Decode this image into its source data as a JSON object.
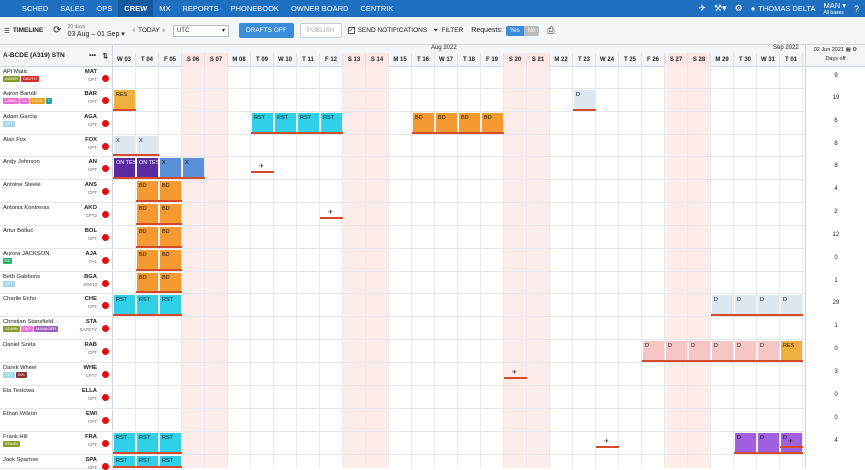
{
  "nav": {
    "items": [
      "SCHED",
      "SALES",
      "OPS",
      "CREW",
      "MX",
      "REPORTS",
      "PHONEBOOK",
      "OWNER BOARD",
      "CENTRIK"
    ],
    "active": "CREW",
    "user": "THOMAS DELTA",
    "base": "MAN",
    "base_sub": "All bases"
  },
  "toolbar": {
    "timeline": "TIMELINE",
    "range_days": "30 days",
    "range": "03 Aug – 01 Sep",
    "today": "TODAY",
    "timezone": "UTC",
    "drafts": "DRAFTS OFF",
    "publish": "PUBLISH",
    "send_notifications": "SEND NOTIFICATIONS",
    "filter": "FILTER",
    "requests": "Requests:",
    "yes": "Yes",
    "no": "No"
  },
  "grid": {
    "group_label": "A-BCDE (A319) STN",
    "month_aug": "Aug 2022",
    "month_sep": "Sep 2022",
    "right_date": "02 Jun 2021",
    "right_label": "Days off",
    "days": [
      "W 03",
      "T 04",
      "F 05",
      "S 06",
      "S 07",
      "M 08",
      "T 09",
      "W 10",
      "T 11",
      "F 12",
      "S 13",
      "S 14",
      "M 15",
      "T 16",
      "W 17",
      "T 18",
      "F 19",
      "S 20",
      "S 21",
      "M 22",
      "T 23",
      "W 24",
      "T 25",
      "F 26",
      "S 27",
      "S 28",
      "M 29",
      "T 30",
      "W 31",
      "T 01"
    ],
    "weekend_idx": [
      3,
      4,
      10,
      11,
      17,
      18,
      24,
      25
    ]
  },
  "crew": [
    {
      "name": "API Matic",
      "code": "MAT",
      "rank": "CPT",
      "tags": [
        {
          "t": "ADMIN",
          "c": "#8a9a2a"
        },
        {
          "t": "DAUTH",
          "c": "#d03030"
        }
      ],
      "days_off": "9"
    },
    {
      "name": "Aaron Bartoli",
      "code": "BAR",
      "rank": "CPT",
      "tags": [
        {
          "t": "LABEL",
          "c": "#e870d0"
        },
        {
          "t": "LL",
          "c": "#e870d0"
        },
        {
          "t": "XXXX",
          "c": "#f0a020"
        },
        {
          "t": "T",
          "c": "#20a0a0"
        }
      ],
      "days_off": "19"
    },
    {
      "name": "Adam Garcia",
      "code": "AGA",
      "rank": "CPT",
      "tags": [
        {
          "t": "CPT",
          "c": "#a0d8e8"
        }
      ],
      "days_off": "6"
    },
    {
      "name": "Alan Fox",
      "code": "FOX",
      "rank": "CPT",
      "tags": [],
      "days_off": "8"
    },
    {
      "name": "Andy Johnson",
      "code": "AN",
      "rank": "CPT",
      "tags": [],
      "days_off": "8"
    },
    {
      "name": "Antoine Steele",
      "code": "ANS",
      "rank": "CPT",
      "tags": [],
      "days_off": "4"
    },
    {
      "name": "Antonia Kontreras",
      "code": "AKO",
      "rank": "CPT2",
      "tags": [],
      "days_off": "2"
    },
    {
      "name": "Artur Boltuć",
      "code": "BOL",
      "rank": "CPT",
      "tags": [],
      "days_off": "12"
    },
    {
      "name": "Aurora JACKSON",
      "code": "AJA",
      "rank": "FA1",
      "tags": [
        {
          "t": "FA",
          "c": "#30b070"
        }
      ],
      "days_off": "0"
    },
    {
      "name": "Beth Gabbons",
      "code": "BGA",
      "rank": "SPA10",
      "tags": [
        {
          "t": "CPT",
          "c": "#a0d8e8"
        }
      ],
      "days_off": "1"
    },
    {
      "name": "Charlie Echo",
      "code": "CHE",
      "rank": "CPT",
      "tags": [],
      "days_off": "29"
    },
    {
      "name": "Christian Stansfield",
      "code": "STA",
      "rank": "SAFETY",
      "tags": [
        {
          "t": "ADMIN",
          "c": "#8a9a2a"
        },
        {
          "t": "DEF",
          "c": "#e870d0"
        },
        {
          "t": "MANAGER",
          "c": "#a060c0"
        }
      ],
      "days_off": "1"
    },
    {
      "name": "Daniel Szela",
      "code": "RAB",
      "rank": "CPT",
      "tags": [],
      "days_off": "0"
    },
    {
      "name": "Darek Wheel",
      "code": "WHE",
      "rank": "CPT7",
      "tags": [
        {
          "t": "CPT",
          "c": "#a0d8e8"
        },
        {
          "t": "INS",
          "c": "#8a3030"
        }
      ],
      "days_off": "3"
    },
    {
      "name": "Ela Testowa",
      "code": "ELLA",
      "rank": "CPT",
      "tags": [],
      "days_off": "0"
    },
    {
      "name": "Ethan Wilson",
      "code": "EWI",
      "rank": "CPT",
      "tags": [],
      "days_off": "0"
    },
    {
      "name": "Frank Hill",
      "code": "FRA",
      "rank": "CPT",
      "tags": [
        {
          "t": "ADMIN",
          "c": "#8a9a2a"
        }
      ],
      "days_off": "4"
    },
    {
      "name": "Jack Sparrow",
      "code": "SPA",
      "rank": "CPT",
      "tags": [],
      "days_off": ""
    }
  ],
  "duties": [
    {
      "row": 1,
      "start": 0,
      "len": 1,
      "label": "RES",
      "color": "#f0b040"
    },
    {
      "row": 1,
      "start": 20,
      "len": 1,
      "label": "D",
      "color": "#dde7f0"
    },
    {
      "row": 2,
      "start": 6,
      "len": 4,
      "label": "RST",
      "color": "#30d0e8",
      "split": true
    },
    {
      "row": 2,
      "start": 13,
      "len": 4,
      "label": "BD",
      "color": "#f59a30",
      "split": true
    },
    {
      "row": 3,
      "start": 0,
      "len": 2,
      "label": "X",
      "color": "#dde7f0",
      "split": true
    },
    {
      "row": 4,
      "start": 0,
      "len": 2,
      "label": "ON TES",
      "color": "#5a2aa0",
      "split": true,
      "light": true
    },
    {
      "row": 4,
      "start": 2,
      "len": 1,
      "label": "X",
      "color": "#5b8fd8"
    },
    {
      "row": 4,
      "start": 3,
      "len": 1,
      "label": "X",
      "color": "#5b8fd8"
    },
    {
      "row": 5,
      "start": 1,
      "len": 2,
      "label": "BD",
      "color": "#f59a30",
      "split": true
    },
    {
      "row": 6,
      "start": 1,
      "len": 2,
      "label": "BD",
      "color": "#f59a30",
      "split": true
    },
    {
      "row": 7,
      "start": 1,
      "len": 2,
      "label": "BD",
      "color": "#f59a30",
      "split": true
    },
    {
      "row": 8,
      "start": 1,
      "len": 2,
      "label": "BD",
      "color": "#f59a30",
      "split": true
    },
    {
      "row": 9,
      "start": 1,
      "len": 2,
      "label": "BD",
      "color": "#f59a30",
      "split": true
    },
    {
      "row": 10,
      "start": 0,
      "len": 3,
      "label": "RST",
      "color": "#30d0e8",
      "split": true
    },
    {
      "row": 10,
      "start": 26,
      "len": 4,
      "label": "D",
      "color": "#dde7f0",
      "split": true
    },
    {
      "row": 12,
      "start": 23,
      "len": 6,
      "label": "D",
      "color": "#f6c6c6",
      "split": true
    },
    {
      "row": 12,
      "start": 29,
      "len": 1,
      "label": "RES",
      "color": "#f0b040"
    },
    {
      "row": 16,
      "start": 0,
      "len": 3,
      "label": "RST",
      "color": "#30d0e8",
      "split": true
    },
    {
      "row": 16,
      "start": 27,
      "len": 3,
      "label": "D",
      "color": "#a060e0",
      "split": true
    },
    {
      "row": 17,
      "start": 0,
      "len": 3,
      "label": "RST",
      "color": "#30d0e8",
      "split": true
    }
  ],
  "marks": [
    {
      "row": 4,
      "col": 6,
      "sym": "✈"
    },
    {
      "row": 6,
      "col": 9,
      "sym": "✈"
    },
    {
      "row": 13,
      "col": 17,
      "sym": "✈"
    },
    {
      "row": 16,
      "col": 21,
      "sym": "✈"
    },
    {
      "row": 16,
      "col": 29,
      "sym": "✈"
    }
  ]
}
